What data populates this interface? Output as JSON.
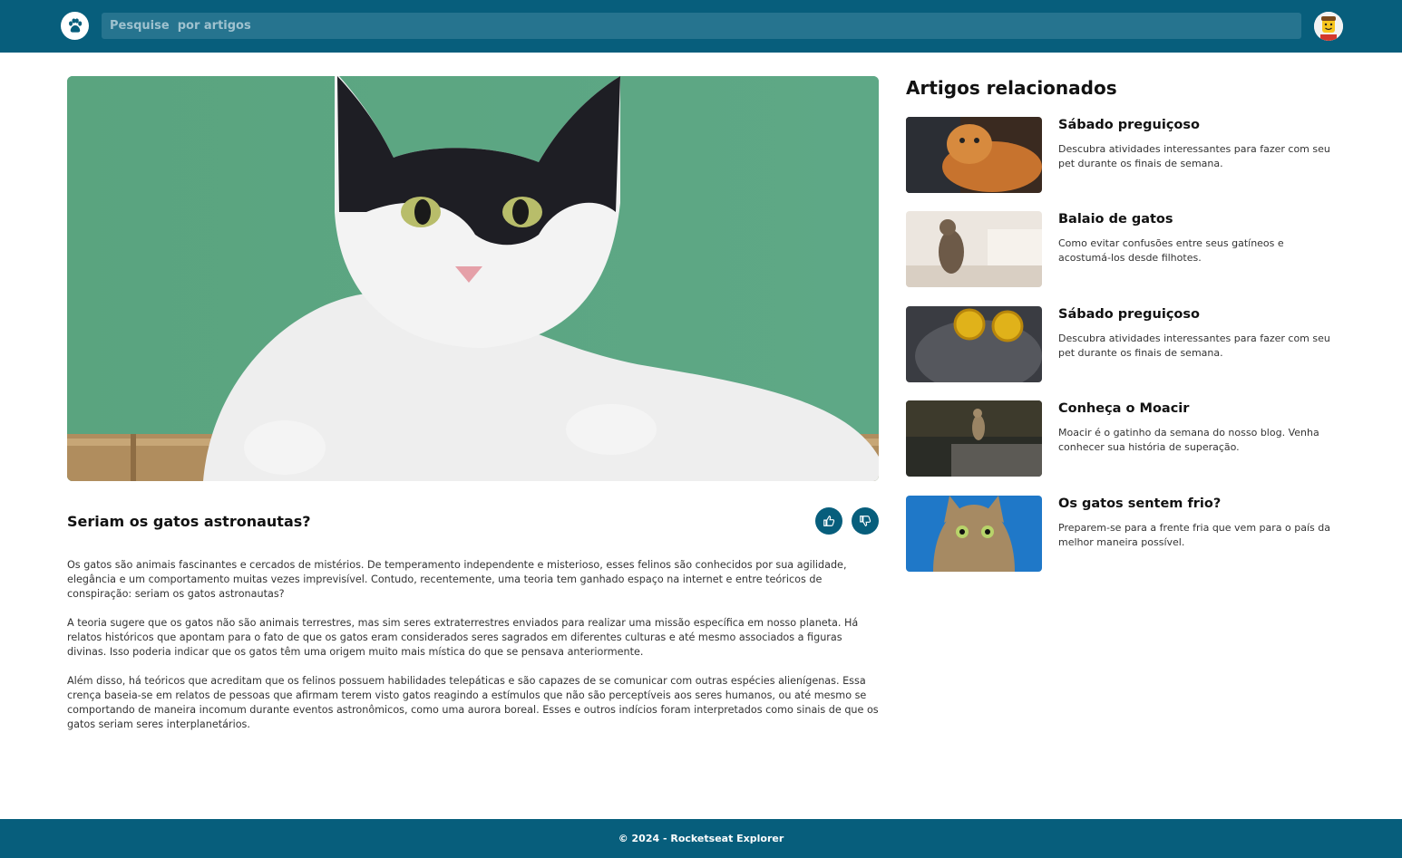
{
  "header": {
    "search_placeholder": "Pesquise  por artigos"
  },
  "article": {
    "title": "Seriam os gatos astronautas?",
    "paragraphs": [
      "Os gatos são animais fascinantes e cercados de mistérios. De temperamento independente e misterioso, esses felinos são conhecidos por sua agilidade, elegância e um comportamento muitas vezes imprevisível. Contudo, recentemente, uma teoria tem ganhado espaço na internet e entre teóricos de conspiração: seriam os gatos astronautas?",
      "A teoria sugere que os gatos não são animais terrestres, mas sim seres extraterrestres enviados para realizar uma missão específica em nosso planeta. Há relatos históricos que apontam para o fato de que os gatos eram considerados seres sagrados em diferentes culturas e até mesmo associados a figuras divinas. Isso poderia indicar que os gatos têm uma origem muito mais mística do que se pensava anteriormente.",
      "Além disso, há teóricos que acreditam que os felinos possuem habilidades telepáticas e são capazes de se comunicar com outras espécies alienígenas. Essa crença baseia-se em relatos de pessoas que afirmam terem visto gatos reagindo a estímulos que não são perceptíveis aos seres humanos, ou até mesmo se comportando de maneira incomum durante eventos astronômicos, como uma aurora boreal. Esses e outros indícios foram interpretados como sinais de que os gatos seriam seres interplanetários."
    ]
  },
  "related": {
    "heading": "Artigos relacionados",
    "items": [
      {
        "title": "Sábado preguiçoso",
        "desc": "Descubra atividades interessantes para fazer com seu pet durante os finais de semana."
      },
      {
        "title": "Balaio de gatos",
        "desc": "Como evitar confusões entre seus gatíneos e acostumá-los desde filhotes."
      },
      {
        "title": "Sábado preguiçoso",
        "desc": "Descubra atividades interessantes para fazer com seu pet durante os finais de semana."
      },
      {
        "title": "Conheça o Moacir",
        "desc": "Moacir é o gatinho da semana do nosso blog. Venha conhecer sua história de superação."
      },
      {
        "title": "Os gatos sentem frio?",
        "desc": "Preparem-se para a frente fria que vem para o país da melhor maneira possível."
      }
    ]
  },
  "footer": {
    "text": "© 2024 - Rocketseat Explorer"
  },
  "colors": {
    "brand": "#075e7c",
    "search_bg": "#26748f"
  }
}
